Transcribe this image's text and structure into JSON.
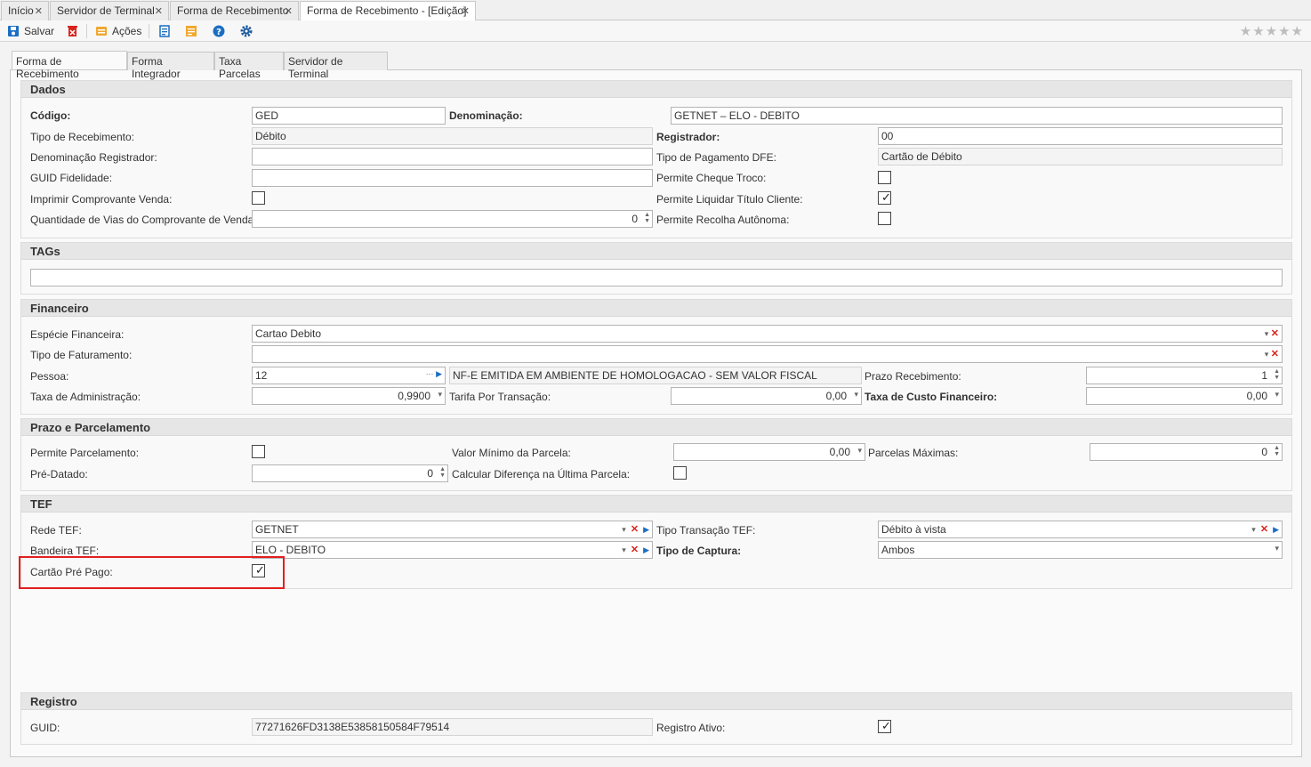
{
  "window_tabs": [
    {
      "label": "Início"
    },
    {
      "label": "Servidor de Terminal"
    },
    {
      "label": "Forma de Recebimento"
    },
    {
      "label": "Forma de Recebimento - [Edição]"
    }
  ],
  "toolbar": {
    "save_label": "Salvar",
    "actions_label": "Ações"
  },
  "form_tabs": [
    "Forma de Recebimento",
    "Forma Integrador",
    "Taxa Parcelas",
    "Servidor de Terminal"
  ],
  "dados": {
    "title": "Dados",
    "codigo_label": "Código:",
    "codigo": "GED",
    "denominacao_label": "Denominação:",
    "denominacao": "GETNET – ELO - DEBITO",
    "tipo_recebimento_label": "Tipo de Recebimento:",
    "tipo_recebimento": "Débito",
    "registrador_label": "Registrador:",
    "registrador": "00",
    "denominacao_registrador_label": "Denominação Registrador:",
    "denominacao_registrador": "",
    "tipo_pagamento_dfe_label": "Tipo de Pagamento DFE:",
    "tipo_pagamento_dfe": "Cartão de Débito",
    "guid_fidelidade_label": "GUID Fidelidade:",
    "guid_fidelidade": "",
    "permite_cheque_troco_label": "Permite Cheque Troco:",
    "permite_cheque_troco": false,
    "imprimir_comprovante_label": "Imprimir Comprovante Venda:",
    "imprimir_comprovante": false,
    "permite_liquidar_label": "Permite Liquidar Título Cliente:",
    "permite_liquidar": true,
    "qtd_vias_label": "Quantidade de Vias do Comprovante de Venda:",
    "qtd_vias": "0",
    "permite_recolha_label": "Permite Recolha Autônoma:",
    "permite_recolha": false
  },
  "tags": {
    "title": "TAGs",
    "value": ""
  },
  "financeiro": {
    "title": "Financeiro",
    "especie_label": "Espécie Financeira:",
    "especie": "Cartao Debito",
    "tipo_faturamento_label": "Tipo de Faturamento:",
    "tipo_faturamento": "",
    "pessoa_label": "Pessoa:",
    "pessoa_codigo": "12",
    "pessoa_nome": "NF-E EMITIDA EM AMBIENTE DE HOMOLOGACAO - SEM VALOR FISCAL",
    "prazo_recebimento_label": "Prazo Recebimento:",
    "prazo_recebimento": "1",
    "taxa_adm_label": "Taxa de Administração:",
    "taxa_adm": "0,9900",
    "tarifa_label": "Tarifa Por Transação:",
    "tarifa": "0,00",
    "taxa_custo_label": "Taxa de Custo Financeiro:",
    "taxa_custo": "0,00"
  },
  "prazo": {
    "title": "Prazo e Parcelamento",
    "permite_parcelamento_label": "Permite Parcelamento:",
    "permite_parcelamento": false,
    "valor_minimo_label": "Valor Mínimo da Parcela:",
    "valor_minimo": "0,00",
    "parcelas_maximas_label": "Parcelas Máximas:",
    "parcelas_maximas": "0",
    "pre_datado_label": "Pré-Datado:",
    "pre_datado": "0",
    "calcular_diferenca_label": "Calcular Diferença na Última Parcela:",
    "calcular_diferenca": false
  },
  "tef": {
    "title": "TEF",
    "rede_label": "Rede TEF:",
    "rede": "GETNET",
    "tipo_transacao_label": "Tipo Transação TEF:",
    "tipo_transacao": "Débito à vista",
    "bandeira_label": "Bandeira TEF:",
    "bandeira": "ELO - DEBITO",
    "tipo_captura_label": "Tipo de Captura:",
    "tipo_captura": "Ambos",
    "cartao_pre_pago_label": "Cartão Pré Pago:",
    "cartao_pre_pago": true
  },
  "registro": {
    "title": "Registro",
    "guid_label": "GUID:",
    "guid": "77271626FD3138E53858150584F79514",
    "registro_ativo_label": "Registro Ativo:",
    "registro_ativo": true
  },
  "colors": {
    "highlight": "#e21f1f",
    "accent": "#1b6ec2",
    "clear": "#d9241c"
  },
  "icons": [
    "save-icon",
    "delete-icon",
    "actions-icon",
    "report-icon",
    "notes-icon",
    "help-icon",
    "settings-icon",
    "star-icon"
  ]
}
